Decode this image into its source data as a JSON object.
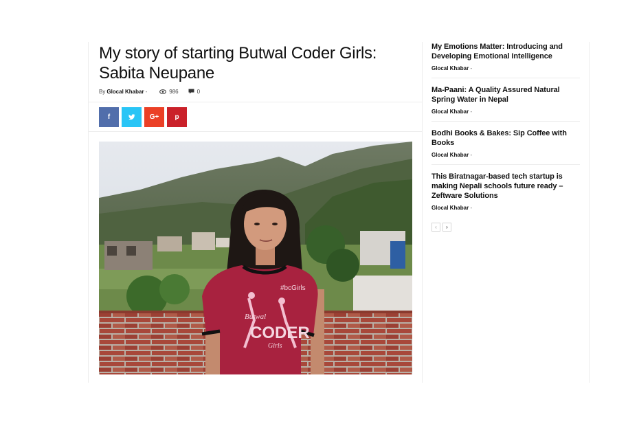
{
  "article": {
    "title": "My story of starting Butwal Coder Girls: Sabita Neupane",
    "by_label": "By",
    "author": "Glocal Khabar",
    "dash": "-",
    "views": "986",
    "comments": "0",
    "icons": {
      "views": "eye-icon",
      "comments": "comment-icon"
    }
  },
  "share": [
    {
      "network": "facebook",
      "glyph": "f",
      "color": "#516eab"
    },
    {
      "network": "twitter",
      "glyph": "t",
      "color": "#29c5f6"
    },
    {
      "network": "google-plus",
      "glyph": "G+",
      "color": "#eb4026"
    },
    {
      "network": "pinterest",
      "glyph": "p",
      "color": "#ca212a"
    }
  ],
  "shirt": {
    "hashtag": "#bcGirls",
    "line1": "Butwal",
    "line2": "CODER",
    "line3": "Girls"
  },
  "sidebar": {
    "items": [
      {
        "title": "My Emotions Matter: Introducing and Developing Emotional Intelligence",
        "author": "Glocal Khabar",
        "dash": "-"
      },
      {
        "title": "Ma-Paani: A Quality Assured Natural Spring Water in Nepal",
        "author": "Glocal Khabar",
        "dash": "-"
      },
      {
        "title": "Bodhi Books & Bakes: Sip Coffee with Books",
        "author": "Glocal Khabar",
        "dash": "-"
      },
      {
        "title": "This Biratnagar-based tech startup is making Nepali schools future ready – Zeftware Solutions",
        "author": "Glocal Khabar",
        "dash": "-"
      }
    ],
    "prev": "‹",
    "next": "›"
  },
  "colors": {
    "facebook": "#516eab",
    "twitter": "#29c5f6",
    "google_plus": "#eb4026",
    "pinterest": "#ca212a",
    "shirt": "#a8223f"
  }
}
